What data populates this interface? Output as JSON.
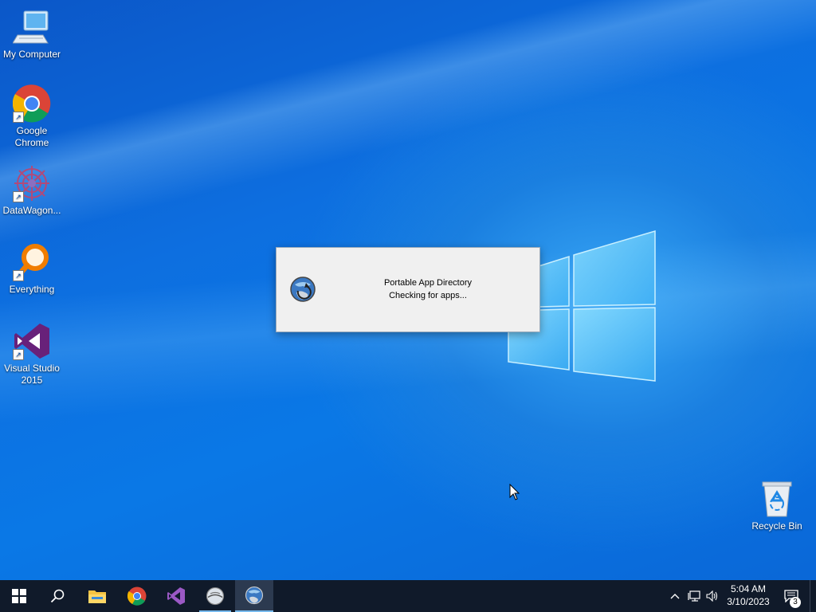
{
  "desktop": {
    "icons": [
      {
        "label": "My Computer",
        "icon": "computer-icon"
      },
      {
        "label": "Google Chrome",
        "icon": "chrome-icon"
      },
      {
        "label": "DataWagon...",
        "icon": "datawagon-icon"
      },
      {
        "label": "Everything",
        "icon": "everything-search-icon"
      },
      {
        "label": "Visual Studio 2015",
        "icon": "visual-studio-icon"
      },
      {
        "label": "Recycle Bin",
        "icon": "recycle-bin-icon"
      }
    ]
  },
  "dialog": {
    "title_line": "Portable App Directory",
    "status_line": "Checking for apps...",
    "icon": "portable-app-globe-icon"
  },
  "taskbar": {
    "apps": [
      {
        "name": "start",
        "icon": "windows-start-icon"
      },
      {
        "name": "search",
        "icon": "search-icon"
      },
      {
        "name": "file-explorer",
        "icon": "folder-icon"
      },
      {
        "name": "chrome",
        "icon": "chrome-icon"
      },
      {
        "name": "visual-studio",
        "icon": "visual-studio-icon"
      },
      {
        "name": "app-globe",
        "icon": "globe-icon"
      },
      {
        "name": "portable-app-directory",
        "icon": "portable-app-globe-icon"
      }
    ],
    "tray": {
      "time": "5:04 AM",
      "date": "3/10/2023",
      "notifications_count": "3"
    }
  },
  "colors": {
    "desktop_blue": "#0a6fe0",
    "taskbar": "#101a2a",
    "accent": "#76b9ed"
  }
}
